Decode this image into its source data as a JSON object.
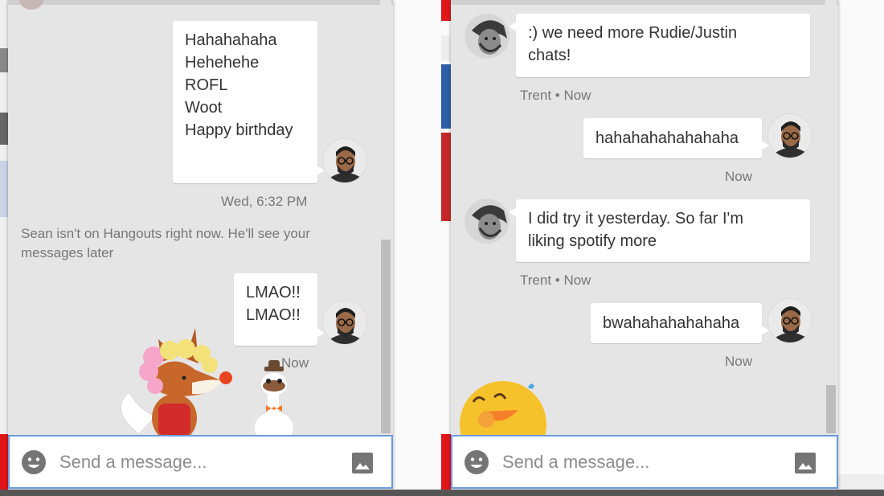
{
  "left_chat": {
    "messages": [
      {
        "lines": [
          "Hahahahaha",
          "Hehehehe",
          "ROFL",
          "Woot",
          "Happy birthday"
        ]
      },
      {
        "lines": [
          "LMAO!!",
          "LMAO!!"
        ]
      }
    ],
    "timestamp1": "Wed, 6:32 PM",
    "system_line1": "Sean isn't on Hangouts right now. He'll see your",
    "system_line2": "messages later",
    "timestamp2": "Now",
    "input_placeholder": "Send a message..."
  },
  "right_chat": {
    "msg1_line1": ":) we need more Rudie/Justin",
    "msg1_line2": "chats!",
    "meta1": "Trent • Now",
    "msg2": "hahahahahahahaha",
    "meta2": "Now",
    "msg3_line1": "I did try it yesterday. So far I'm",
    "msg3_line2": "liking spotify more",
    "meta3": "Trent • Now",
    "msg4": "bwahahahahahaha",
    "meta4": "Now",
    "input_placeholder": "Send a message..."
  },
  "icons": {
    "emoji": "emoji-smiley-icon",
    "photo": "insert-photo-icon",
    "sticker_left": "fox-and-goose-sticker",
    "sticker_right": "laughing-sticker"
  },
  "colors": {
    "accent_border": "#6b9be0",
    "chat_bg": "#e5e5e5",
    "bubble": "#ffffff",
    "bg_red": "#e0161b"
  }
}
